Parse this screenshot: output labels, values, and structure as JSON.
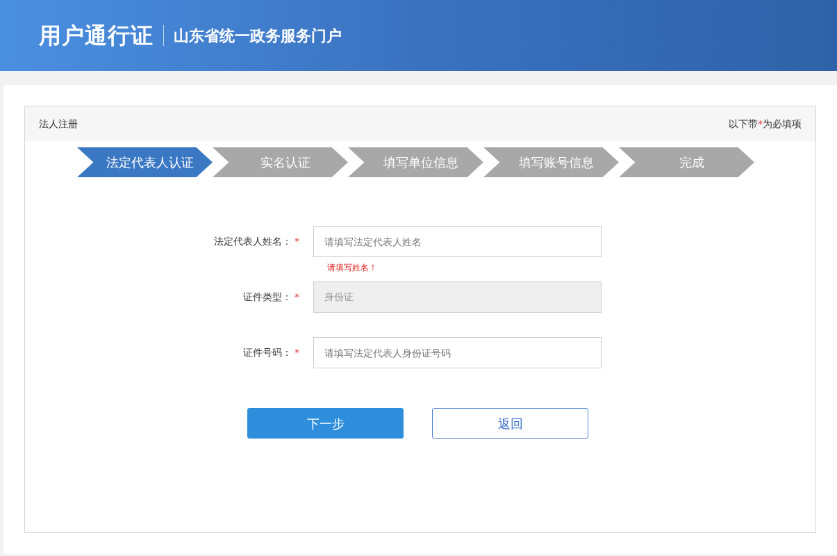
{
  "header": {
    "title": "用户通行证",
    "subtitle": "山东省统一政务服务门户"
  },
  "panel": {
    "title": "法人注册",
    "required_note": {
      "before": "以下带",
      "mark": "*",
      "after": "为必填项"
    }
  },
  "steps": [
    {
      "label": "法定代表人认证",
      "selected": true
    },
    {
      "label": "实名认证",
      "selected": false
    },
    {
      "label": "填写单位信息",
      "selected": false
    },
    {
      "label": "填写账号信息",
      "selected": false
    },
    {
      "label": "完成",
      "selected": false
    }
  ],
  "fields": [
    {
      "label": "法定代表人姓名：",
      "required_mark": "*",
      "placeholder": "请填写法定代表人姓名",
      "disabled": false,
      "error": "请填写姓名！"
    },
    {
      "label": "证件类型：",
      "required_mark": "*",
      "value": "身份证",
      "disabled": true
    },
    {
      "label": "证件号码：",
      "required_mark": "*",
      "placeholder": "请填写法定代表人身份证号码",
      "disabled": false
    }
  ],
  "buttons": [
    {
      "label": "下一步",
      "kind": "primary"
    },
    {
      "label": "返回",
      "kind": "outline"
    }
  ]
}
